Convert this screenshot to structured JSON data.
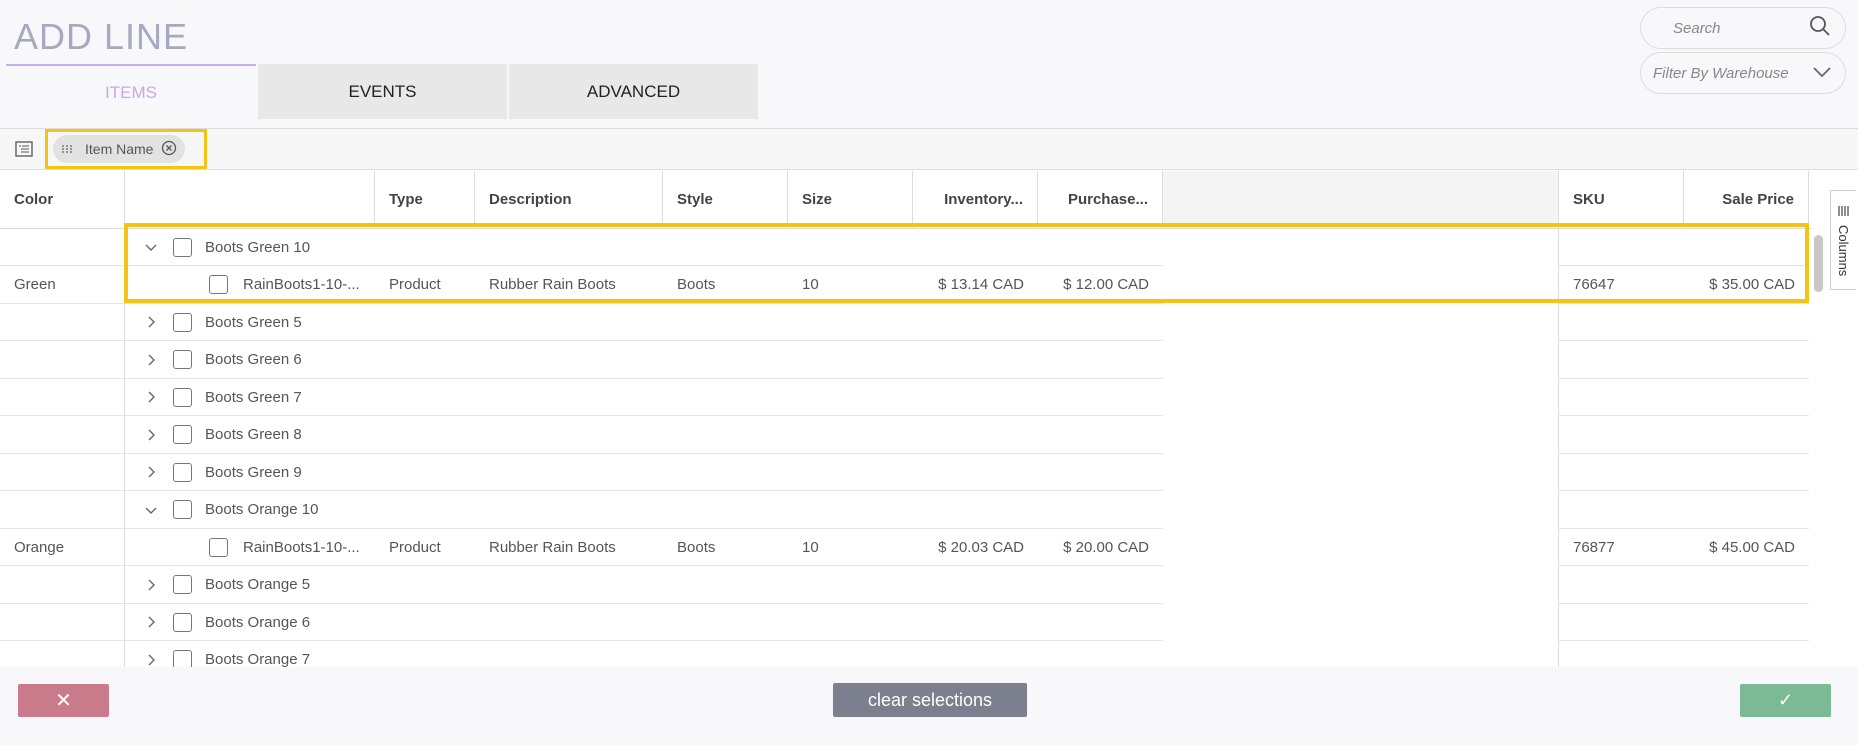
{
  "page": {
    "title": "ADD LINE"
  },
  "tabs": [
    {
      "label": "ITEMS"
    },
    {
      "label": "EVENTS"
    },
    {
      "label": "ADVANCED"
    }
  ],
  "search": {
    "placeholder": "Search"
  },
  "filter": {
    "placeholder": "Filter By Warehouse"
  },
  "grouping": {
    "chip_label": "Item Name"
  },
  "columns": {
    "color": "Color",
    "type": "Type",
    "description": "Description",
    "style": "Style",
    "size": "Size",
    "inventory": "Inventory...",
    "purchase": "Purchase...",
    "sku": "SKU",
    "sale_price": "Sale Price"
  },
  "side_panel": {
    "label": "Columns"
  },
  "groups": [
    {
      "name": "Boots Green 10",
      "expanded": true
    },
    {
      "name": "Boots Green 5"
    },
    {
      "name": "Boots Green 6"
    },
    {
      "name": "Boots Green 7"
    },
    {
      "name": "Boots Green 8"
    },
    {
      "name": "Boots Green 9"
    },
    {
      "name": "Boots Orange 10",
      "expanded": true
    },
    {
      "name": "Boots Orange 5"
    },
    {
      "name": "Boots Orange 6"
    },
    {
      "name": "Boots Orange 7"
    }
  ],
  "items": [
    {
      "color": "Green",
      "name": "RainBoots1-10-...",
      "type": "Product",
      "description": "Rubber Rain Boots",
      "style": "Boots",
      "size": "10",
      "inventory": "$ 13.14 CAD",
      "purchase": "$ 12.00 CAD",
      "sku": "76647",
      "sale_price": "$ 35.00 CAD"
    },
    {
      "color": "Orange",
      "name": "RainBoots1-10-...",
      "type": "Product",
      "description": "Rubber Rain Boots",
      "style": "Boots",
      "size": "10",
      "inventory": "$ 20.03 CAD",
      "purchase": "$ 20.00 CAD",
      "sku": "76877",
      "sale_price": "$ 45.00 CAD"
    }
  ],
  "footer": {
    "cancel_label": "✕",
    "clear_label": "clear selections",
    "confirm_label": "✓"
  }
}
